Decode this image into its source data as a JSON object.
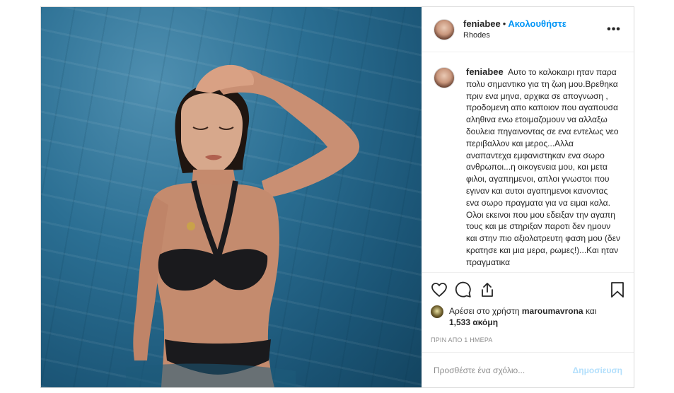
{
  "post": {
    "image_alt_icon": "photo",
    "colors": {
      "accent": "#0095f6",
      "text": "#262626",
      "muted": "#8e8e8e",
      "border": "#dbdbdb",
      "post_disabled": "#b2dffc"
    }
  },
  "header": {
    "username": "feniabee",
    "separator": "•",
    "follow_label": "Ακολουθήστε",
    "location": "Rhodes",
    "more_icon": "more-options-icon",
    "more_label": "•••"
  },
  "caption": {
    "username": "feniabee",
    "text": "Αυτο το καλοκαιρι ηταν παρα πολυ σημαντικο για τη ζωη μου.Βρεθηκα πριν ενα μηνα, αρχικα σε απογνωση , προδομενη απο καποιον που αγαπουσα αληθινα ενω ετοιμαζομουν να αλλαξω δουλεια πηγαινοντας σε ενα εντελως νεο περιβαλλον και μερος...Αλλα αναπαντεχα εμφανιστηκαν ενα σωρο ανθρωποι...η οικογενεια μου, και μετα φιλοι, αγαπημενοι, απλοι γνωστοι που εγιναν και αυτοι αγαπημενοι κανοντας ενα σωρο πραγματα για να ειμαι καλα. Ολοι εκεινοι που μου εδειξαν την αγαπη τους και με στηριξαν παροτι δεν ημουν και στην πιο αξιολατρευτη φαση μου (δεν κρατησε και μια μερα, ρωμες!)...Και ηταν πραγματικα"
  },
  "actions": {
    "like_icon": "heart-icon",
    "comment_icon": "comment-icon",
    "share_icon": "share-icon",
    "save_icon": "bookmark-icon"
  },
  "likes": {
    "prefix": "Αρέσει στο χρήστη",
    "user": "maroumavrona",
    "and": "και",
    "count": "1,533 ακόμη"
  },
  "timestamp": "ΠΡΙΝ ΑΠΟ 1 ΗΜΕΡΑ",
  "comment_box": {
    "placeholder": "Προσθέστε ένα σχόλιο...",
    "post_label": "Δημοσίευση"
  }
}
